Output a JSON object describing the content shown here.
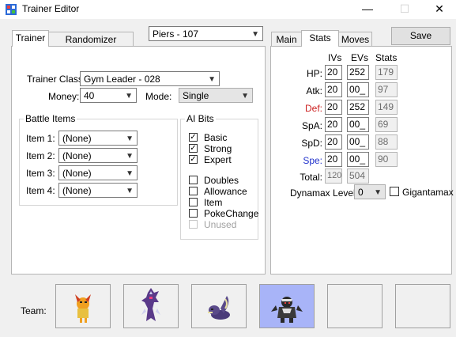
{
  "window": {
    "title": "Trainer Editor",
    "minimize": "—",
    "maximize": "☐",
    "close": "✕"
  },
  "trainer_select": "Piers - 107",
  "left_tabs": [
    "Trainer",
    "Randomizer Options"
  ],
  "trainer": {
    "class_label": "Trainer Class:",
    "class_value": "Gym Leader - 028",
    "money_label": "Money:",
    "money_value": "40",
    "mode_label": "Mode:",
    "mode_value": "Single"
  },
  "battle_items": {
    "title": "Battle Items",
    "items": [
      {
        "label": "Item 1:",
        "value": "(None)"
      },
      {
        "label": "Item 2:",
        "value": "(None)"
      },
      {
        "label": "Item 3:",
        "value": "(None)"
      },
      {
        "label": "Item 4:",
        "value": "(None)"
      }
    ]
  },
  "ai_bits": {
    "title": "AI Bits",
    "checks": [
      {
        "label": "Basic",
        "checked": true
      },
      {
        "label": "Strong",
        "checked": true
      },
      {
        "label": "Expert",
        "checked": true
      },
      {
        "label": "Doubles",
        "checked": false
      },
      {
        "label": "Allowance",
        "checked": false
      },
      {
        "label": "Item",
        "checked": false
      },
      {
        "label": "PokeChange",
        "checked": false
      },
      {
        "label": "Unused",
        "checked": false,
        "disabled": true
      }
    ]
  },
  "right_tabs": [
    "Main",
    "Stats",
    "Moves"
  ],
  "save_label": "Save",
  "stats": {
    "headers": [
      "IVs",
      "EVs",
      "Stats"
    ],
    "rows": [
      {
        "label": "HP:",
        "iv": "20",
        "ev": "252",
        "stat": "179",
        "color": "#000000"
      },
      {
        "label": "Atk:",
        "iv": "20",
        "ev": "00_",
        "stat": "97",
        "color": "#000000"
      },
      {
        "label": "Def:",
        "iv": "20",
        "ev": "252",
        "stat": "149",
        "color": "#cc2222"
      },
      {
        "label": "SpA:",
        "iv": "20",
        "ev": "00_",
        "stat": "69",
        "color": "#000000"
      },
      {
        "label": "SpD:",
        "iv": "20",
        "ev": "00_",
        "stat": "88",
        "color": "#000000"
      },
      {
        "label": "Spe:",
        "iv": "20",
        "ev": "00_",
        "stat": "90",
        "color": "#2233cc"
      }
    ],
    "total_label": "Total:",
    "total_iv": "120",
    "total_ev": "504",
    "dynamax_label": "Dynamax Level:",
    "dynamax_value": "0",
    "gigantamax_label": "Gigantamax"
  },
  "team": {
    "label": "Team:",
    "slots": [
      {
        "icon": "scrafty-sprite-icon",
        "selected": false
      },
      {
        "icon": "toxtricity-sprite-icon",
        "selected": false
      },
      {
        "icon": "skuntank-sprite-icon",
        "selected": false
      },
      {
        "icon": "obstagoon-sprite-icon",
        "selected": true
      },
      {
        "icon": "empty-slot",
        "selected": false
      },
      {
        "icon": "empty-slot",
        "selected": false
      }
    ]
  }
}
